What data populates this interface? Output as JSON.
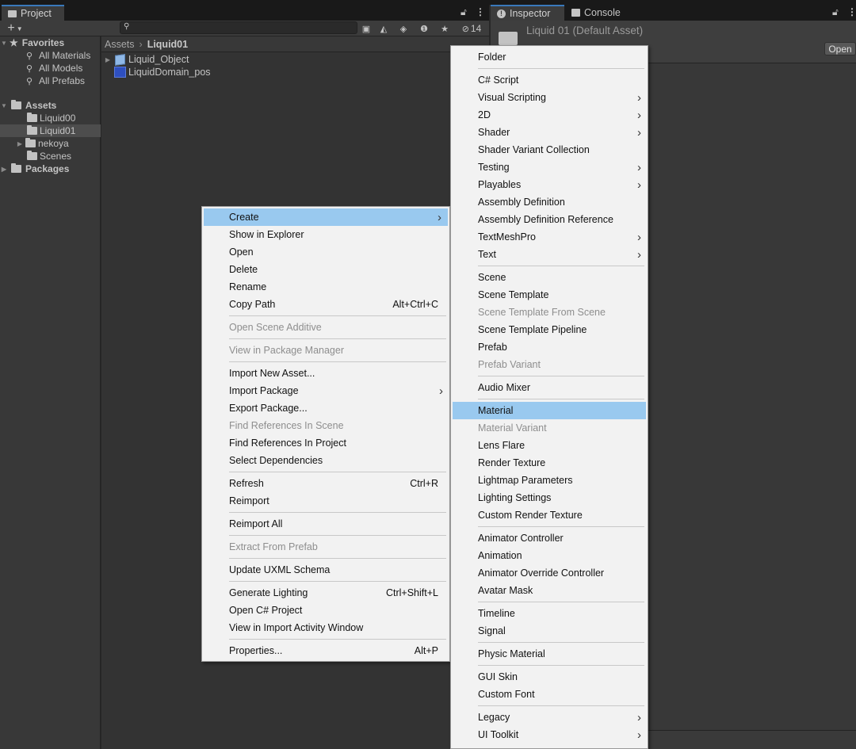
{
  "project_tab": {
    "label": "Project",
    "icon": "folder-icon"
  },
  "inspector_tab": {
    "label": "Inspector",
    "icon": "info-icon"
  },
  "console_tab": {
    "label": "Console",
    "icon": "console-icon"
  },
  "toolbar": {
    "add_icon": "plus-icon",
    "hidden_count": "14"
  },
  "tree": {
    "favorites": {
      "label": "Favorites",
      "items": [
        "All Materials",
        "All Models",
        "All Prefabs"
      ]
    },
    "assets": {
      "label": "Assets",
      "items": [
        "Liquid00",
        "Liquid01",
        "nekoya",
        "Scenes"
      ]
    },
    "packages": {
      "label": "Packages"
    }
  },
  "breadcrumb": {
    "root": "Assets",
    "current": "Liquid01"
  },
  "assets_list": [
    "Liquid_Object",
    "LiquidDomain_pos"
  ],
  "inspector": {
    "title": "Liquid 01 (Default Asset)",
    "open_button": "Open"
  },
  "context_menu": {
    "items": [
      {
        "label": "Create",
        "submenu": true,
        "highlighted": true
      },
      {
        "label": "Show in Explorer"
      },
      {
        "label": "Open"
      },
      {
        "label": "Delete"
      },
      {
        "label": "Rename"
      },
      {
        "label": "Copy Path",
        "shortcut": "Alt+Ctrl+C"
      },
      {
        "label": "Open Scene Additive",
        "disabled": true
      },
      {
        "label": "View in Package Manager",
        "disabled": true
      },
      {
        "label": "Import New Asset..."
      },
      {
        "label": "Import Package",
        "submenu": true
      },
      {
        "label": "Export Package..."
      },
      {
        "label": "Find References In Scene",
        "disabled": true
      },
      {
        "label": "Find References In Project"
      },
      {
        "label": "Select Dependencies"
      },
      {
        "label": "Refresh",
        "shortcut": "Ctrl+R"
      },
      {
        "label": "Reimport"
      },
      {
        "label": "Reimport All"
      },
      {
        "label": "Extract From Prefab",
        "disabled": true
      },
      {
        "label": "Update UXML Schema"
      },
      {
        "label": "Generate Lighting",
        "shortcut": "Ctrl+Shift+L"
      },
      {
        "label": "Open C# Project"
      },
      {
        "label": "View in Import Activity Window"
      },
      {
        "label": "Properties...",
        "shortcut": "Alt+P"
      }
    ]
  },
  "create_submenu": {
    "items": [
      {
        "label": "Folder"
      },
      {
        "label": "C# Script"
      },
      {
        "label": "Visual Scripting",
        "submenu": true
      },
      {
        "label": "2D",
        "submenu": true
      },
      {
        "label": "Shader",
        "submenu": true
      },
      {
        "label": "Shader Variant Collection"
      },
      {
        "label": "Testing",
        "submenu": true
      },
      {
        "label": "Playables",
        "submenu": true
      },
      {
        "label": "Assembly Definition"
      },
      {
        "label": "Assembly Definition Reference"
      },
      {
        "label": "TextMeshPro",
        "submenu": true
      },
      {
        "label": "Text",
        "submenu": true
      },
      {
        "label": "Scene"
      },
      {
        "label": "Scene Template"
      },
      {
        "label": "Scene Template From Scene",
        "disabled": true
      },
      {
        "label": "Scene Template Pipeline"
      },
      {
        "label": "Prefab"
      },
      {
        "label": "Prefab Variant",
        "disabled": true
      },
      {
        "label": "Audio Mixer"
      },
      {
        "label": "Material",
        "highlighted": true
      },
      {
        "label": "Material Variant",
        "disabled": true
      },
      {
        "label": "Lens Flare"
      },
      {
        "label": "Render Texture"
      },
      {
        "label": "Lightmap Parameters"
      },
      {
        "label": "Lighting Settings"
      },
      {
        "label": "Custom Render Texture"
      },
      {
        "label": "Animator Controller"
      },
      {
        "label": "Animation"
      },
      {
        "label": "Animator Override Controller"
      },
      {
        "label": "Avatar Mask"
      },
      {
        "label": "Timeline"
      },
      {
        "label": "Signal"
      },
      {
        "label": "Physic Material"
      },
      {
        "label": "GUI Skin"
      },
      {
        "label": "Custom Font"
      },
      {
        "label": "Legacy",
        "submenu": true
      },
      {
        "label": "UI Toolkit",
        "submenu": true
      }
    ]
  },
  "colors": {
    "highlight": "#99c9ef",
    "menu_bg": "#f2f2f2",
    "editor_bg": "#383838",
    "selected_row": "#4d4d4d"
  }
}
